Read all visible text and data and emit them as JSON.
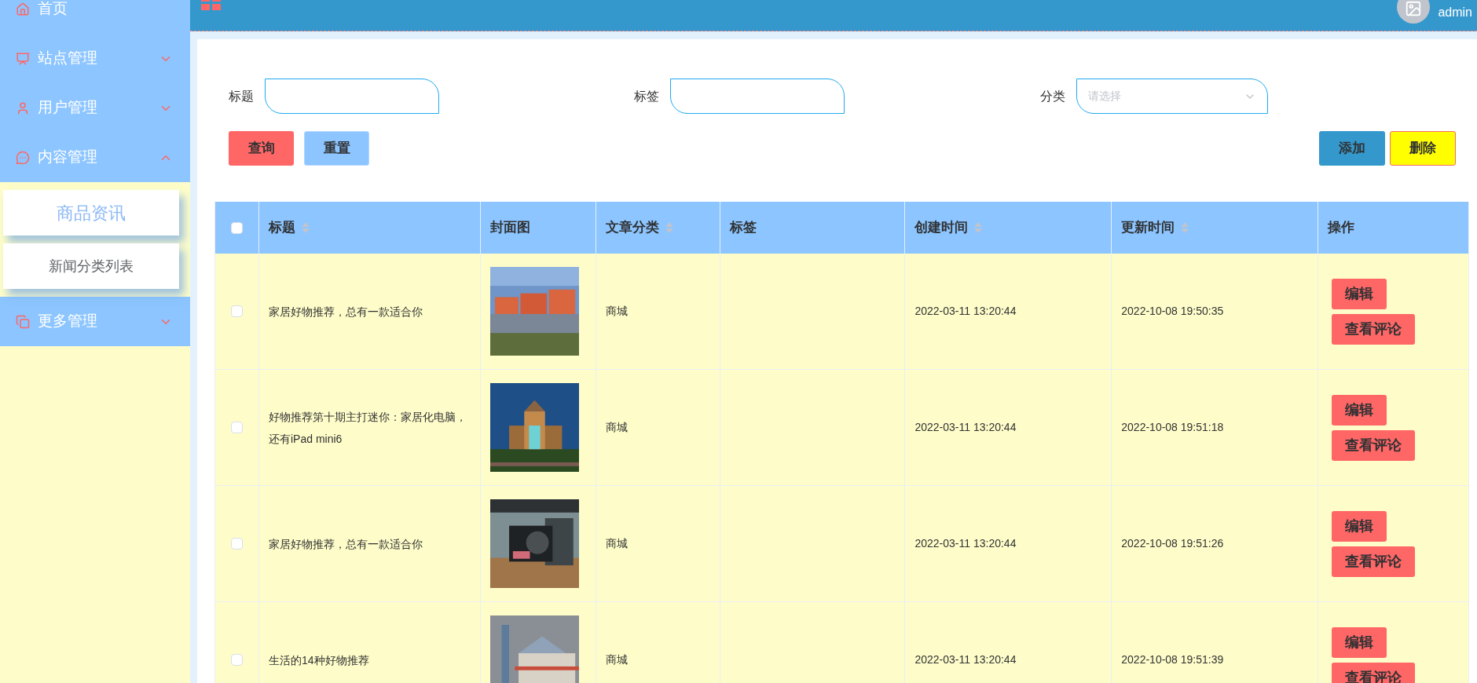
{
  "sidebar": {
    "items": [
      {
        "label": "首页"
      },
      {
        "label": "站点管理",
        "expanded": false
      },
      {
        "label": "用户管理",
        "expanded": false
      },
      {
        "label": "内容管理",
        "expanded": true,
        "children": [
          {
            "label": "商品资讯",
            "selected": true
          },
          {
            "label": "新闻分类列表",
            "selected": false
          }
        ]
      },
      {
        "label": "更多管理",
        "expanded": false
      }
    ]
  },
  "header": {
    "user": "admin"
  },
  "filters": [
    {
      "label": "标题",
      "kind": "text"
    },
    {
      "label": "标签",
      "kind": "text"
    },
    {
      "label": "分类",
      "kind": "select",
      "placeholder": "请选择"
    }
  ],
  "left_buttons": [
    {
      "label": "查询",
      "kind": "search"
    },
    {
      "label": "重置",
      "kind": "reset"
    }
  ],
  "right_buttons": [
    {
      "label": "添加",
      "kind": "add"
    },
    {
      "label": "删除",
      "kind": "delete"
    }
  ],
  "table": {
    "header_checked": false,
    "columns": [
      {
        "label": "标题",
        "sortable": true
      },
      {
        "label": "封面图",
        "sortable": false
      },
      {
        "label": "文章分类",
        "sortable": true
      },
      {
        "label": "标签",
        "sortable": false
      },
      {
        "label": "创建时间",
        "sortable": true
      },
      {
        "label": "更新时间",
        "sortable": true
      },
      {
        "label": "操作",
        "sortable": false
      }
    ],
    "rows": [
      {
        "checked": false,
        "title": "家居好物推荐，总有一款适合你",
        "cover": {
          "kind": "picture"
        },
        "category": "商城",
        "created": "2022-03-11 13:20:44",
        "updated": "2022-10-08 19:50:35",
        "actions": [
          "编辑",
          "查看评论"
        ]
      },
      {
        "checked": false,
        "title": "好物推荐第十期主打迷你：家居化电脑，还有iPad mini6",
        "cover": {
          "kind": "picture"
        },
        "category": "商城",
        "created": "2022-03-11 13:20:44",
        "updated": "2022-10-08 19:51:18",
        "actions": [
          "编辑",
          "查看评论"
        ]
      },
      {
        "checked": false,
        "title": "家居好物推荐，总有一款适合你",
        "cover": {
          "kind": "picture"
        },
        "category": "商城",
        "created": "2022-03-11 13:20:44",
        "updated": "2022-10-08 19:51:26",
        "actions": [
          "编辑",
          "查看评论"
        ]
      },
      {
        "checked": false,
        "title": "生活的14种好物推荐",
        "cover": {
          "kind": "picture"
        },
        "category": "商城",
        "created": "2022-03-11 13:20:44",
        "updated": "2022-10-08 19:51:39",
        "actions": [
          "编辑",
          "查看评论"
        ]
      }
    ]
  }
}
